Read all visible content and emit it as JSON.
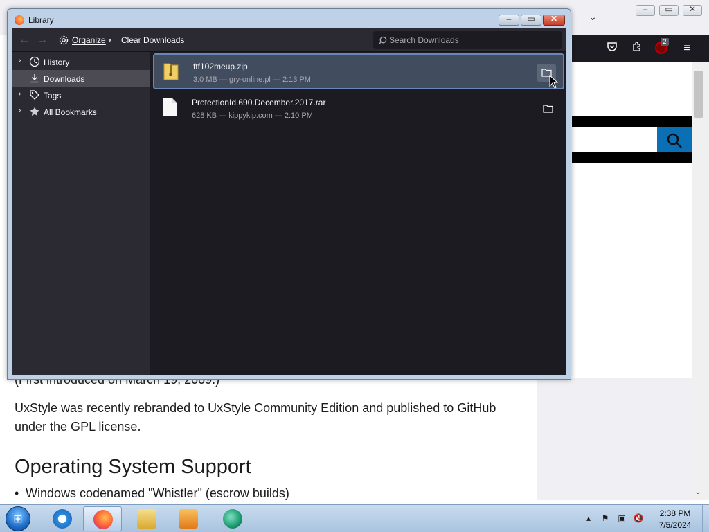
{
  "library": {
    "title": "Library",
    "toolbar": {
      "organize_label": "Organize",
      "clear_label": "Clear Downloads",
      "search_placeholder": "Search Downloads"
    },
    "sidebar": {
      "items": [
        {
          "label": "History",
          "icon": "clock-icon",
          "expandable": true,
          "selected": false
        },
        {
          "label": "Downloads",
          "icon": "download-icon",
          "expandable": false,
          "selected": true
        },
        {
          "label": "Tags",
          "icon": "tag-icon",
          "expandable": true,
          "selected": false
        },
        {
          "label": "All Bookmarks",
          "icon": "star-icon",
          "expandable": true,
          "selected": false
        }
      ]
    },
    "downloads": [
      {
        "name": "ftf102meup.zip",
        "meta": "3.0 MB — gry-online.pl — 2:13 PM",
        "icon": "zip-folder-icon",
        "selected": true
      },
      {
        "name": "ProtectionId.690.December.2017.rar",
        "meta": "628 KB — kippykip.com — 2:10 PM",
        "icon": "file-icon",
        "selected": false
      }
    ]
  },
  "browser": {
    "extension_badge": "2"
  },
  "article": {
    "partial_line": "(First introduced on March 19, 2009.)",
    "paragraph": "UxStyle was recently rebranded to UxStyle Community Edition and published to GitHub under the GPL license.",
    "heading": "Operating System Support",
    "bullet": "Windows codenamed \"Whistler\" (escrow builds)"
  },
  "taskbar": {
    "time": "2:38 PM",
    "date": "7/5/2024"
  },
  "colors": {
    "accent": "#0a6fb5",
    "library_bg": "#1c1b22",
    "sidebar_bg": "#2b2a33",
    "selected_row": "#414c5e"
  }
}
